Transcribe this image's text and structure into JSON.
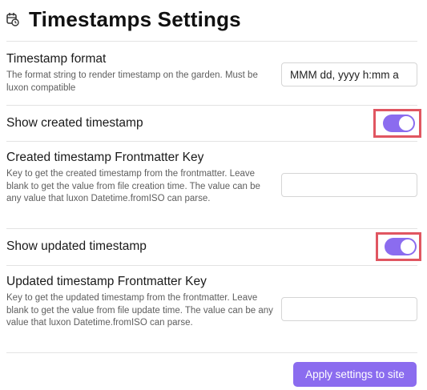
{
  "header": {
    "title": "Timestamps Settings",
    "icon": "calendar-clock-icon"
  },
  "settings": [
    {
      "title": "Timestamp format",
      "description": "The format string to render timestamp on the garden. Must be luxon compatible",
      "value": "MMM dd, yyyy h:mm a"
    },
    {
      "title": "Show created timestamp",
      "toggle": true
    },
    {
      "title": "Created timestamp Frontmatter Key",
      "description": "Key to get the created timestamp from the frontmatter. Leave blank to get the value from file creation time. The value can be any value that luxon Datetime.fromISO can parse.",
      "value": ""
    },
    {
      "title": "Show updated timestamp",
      "toggle": true
    },
    {
      "title": "Updated timestamp Frontmatter Key",
      "description": "Key to get the updated timestamp from the frontmatter. Leave blank to get the value from file update time. The value can be any value that luxon Datetime.fromISO can parse.",
      "value": ""
    }
  ],
  "actions": {
    "apply_label": "Apply settings to site"
  },
  "colors": {
    "accent": "#8b6cef",
    "highlight": "#e05661",
    "divider": "#e3e3e3"
  }
}
